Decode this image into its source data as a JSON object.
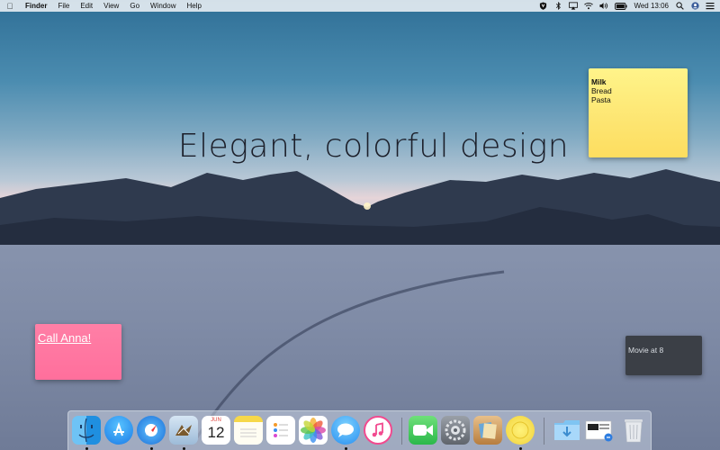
{
  "menubar": {
    "apple_label": "",
    "app_name": "Finder",
    "menus": [
      "File",
      "Edit",
      "View",
      "Go",
      "Window",
      "Help"
    ],
    "clock": "Wed 13:06"
  },
  "desktop": {
    "headline": "Elegant, colorful design"
  },
  "stickies": {
    "yellow": {
      "title": "Milk",
      "lines": [
        "Bread",
        "Pasta"
      ]
    },
    "pink": {
      "text": "Call Anna!"
    },
    "dark": {
      "text": "Movie at 8"
    }
  },
  "dock": {
    "calendar_month": "JUN",
    "calendar_day": "12",
    "items": [
      "finder-icon",
      "app-store-icon",
      "safari-icon",
      "mail-icon",
      "calendar-icon",
      "notes-icon",
      "reminders-icon",
      "photos-icon",
      "messages-icon",
      "itunes-icon",
      "facetime-icon",
      "system-preferences-icon",
      "preview-icon",
      "stickies-icon",
      "downloads-folder-icon",
      "documents-stack-icon",
      "trash-icon"
    ]
  },
  "colors": {
    "sticky_yellow": "#fde571",
    "sticky_pink": "#ff6f9c",
    "sticky_dark": "#3b3f46"
  }
}
